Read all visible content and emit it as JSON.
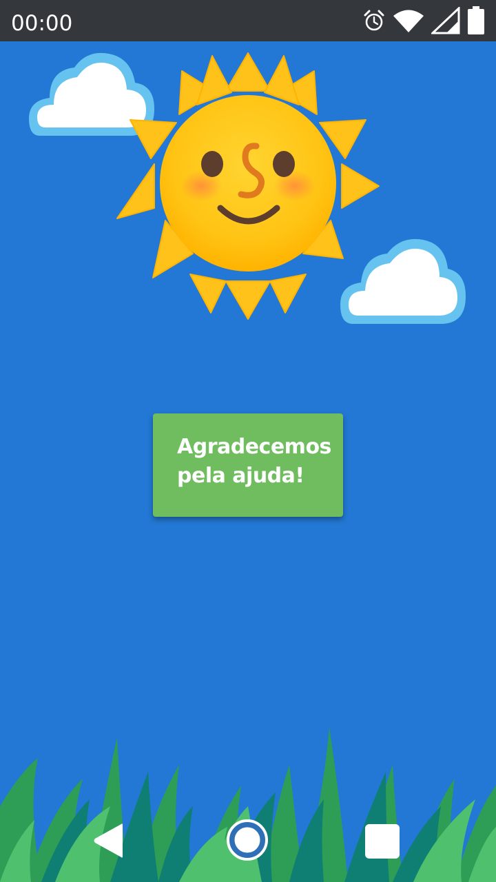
{
  "status_bar": {
    "time": "00:00",
    "icons": [
      "alarm-icon",
      "wifi-icon",
      "cell-signal-icon",
      "battery-icon"
    ],
    "background_color": "#34373C"
  },
  "main": {
    "background_color": "#2278D4",
    "illustration": {
      "sun": "smiling-sun-icon",
      "clouds": [
        "cloud-icon",
        "cloud-icon"
      ],
      "ground": "grass-illustration"
    },
    "message": {
      "text": "Agradecemos\npela ajuda!",
      "card_color": "#6FBD5F"
    }
  },
  "nav_bar": {
    "buttons": [
      "back-icon",
      "home-icon",
      "recents-icon"
    ]
  }
}
